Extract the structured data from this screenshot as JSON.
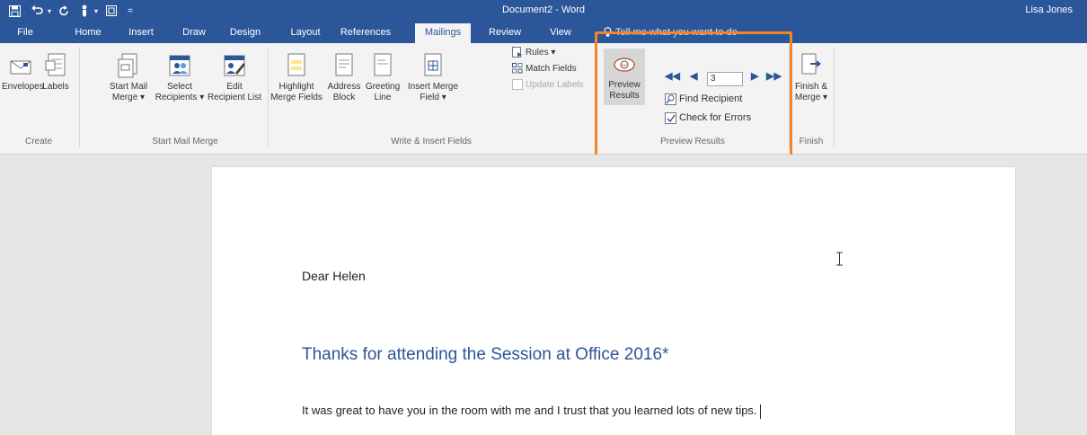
{
  "titlebar": {
    "title": "Document2 - Word",
    "user": "Lisa Jones",
    "quick_access": [
      "save-icon",
      "undo-icon",
      "redo-icon",
      "touch-mode-icon",
      "customize-icon"
    ]
  },
  "tabs": [
    {
      "label": "File",
      "active": false
    },
    {
      "label": "Home",
      "active": false
    },
    {
      "label": "Insert",
      "active": false
    },
    {
      "label": "Draw",
      "active": false
    },
    {
      "label": "Design",
      "active": false
    },
    {
      "label": "Layout",
      "active": false
    },
    {
      "label": "References",
      "active": false
    },
    {
      "label": "Mailings",
      "active": true
    },
    {
      "label": "Review",
      "active": false
    },
    {
      "label": "View",
      "active": false
    }
  ],
  "tell_me": "Tell me what you want to do",
  "ribbon": {
    "create": {
      "envelopes": "Envelopes",
      "labels": "Labels",
      "group": "Create"
    },
    "start_mail_merge": {
      "start_l1": "Start Mail",
      "start_l2": "Merge",
      "select_l1": "Select",
      "select_l2": "Recipients",
      "edit_l1": "Edit",
      "edit_l2": "Recipient List",
      "group": "Start Mail Merge"
    },
    "write_insert": {
      "highlight_l1": "Highlight",
      "highlight_l2": "Merge Fields",
      "address_l1": "Address",
      "address_l2": "Block",
      "greeting_l1": "Greeting",
      "greeting_l2": "Line",
      "insert_l1": "Insert Merge",
      "insert_l2": "Field",
      "rules": "Rules",
      "match_fields": "Match Fields",
      "update_labels": "Update Labels",
      "group": "Write & Insert Fields"
    },
    "preview": {
      "preview_l1": "Preview",
      "preview_l2": "Results",
      "record_number": "3",
      "find_recipient": "Find Recipient",
      "check_errors": "Check for Errors",
      "group": "Preview Results"
    },
    "finish": {
      "finish_l1": "Finish &",
      "finish_l2": "Merge",
      "group": "Finish"
    }
  },
  "document": {
    "salutation": "Dear Helen",
    "heading": "Thanks for attending the Session at Office 2016*",
    "body": "It was great to have you in the room with me and I trust that you learned lots of new tips."
  },
  "colors": {
    "brand": "#2b579a",
    "highlight": "#f0852c",
    "heading": "#2f5496"
  }
}
